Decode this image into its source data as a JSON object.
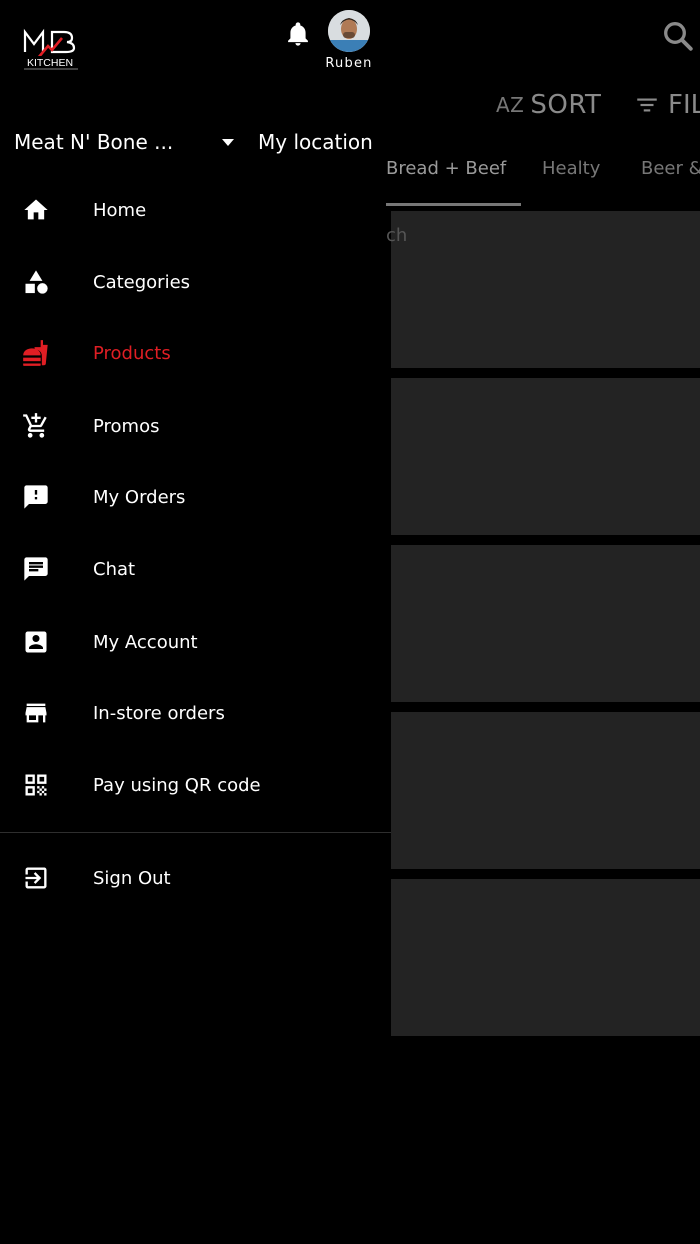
{
  "user": {
    "name": "Ruben"
  },
  "store": {
    "name": "Meat N' Bone ...",
    "location_label": "My location"
  },
  "toolbar": {
    "sort_label": "SORT",
    "sort_icon_text": "AZ",
    "filter_label": "FIL"
  },
  "tabs": [
    {
      "label": "Bread + Beef",
      "active": true
    },
    {
      "label": "Healty",
      "active": false
    },
    {
      "label": "Beer &",
      "active": false
    }
  ],
  "search": {
    "ghost_text": "ch"
  },
  "menu": {
    "items": [
      {
        "label": "Home",
        "icon": "home-icon",
        "active": false
      },
      {
        "label": "Categories",
        "icon": "categories-icon",
        "active": false
      },
      {
        "label": "Products",
        "icon": "fastfood-icon",
        "active": true
      },
      {
        "label": "Promos",
        "icon": "add-to-cart-icon",
        "active": false
      },
      {
        "label": "My Orders",
        "icon": "feedback-icon",
        "active": false
      },
      {
        "label": "Chat",
        "icon": "chat-icon",
        "active": false
      },
      {
        "label": "My Account",
        "icon": "account-box-icon",
        "active": false
      },
      {
        "label": "In-store orders",
        "icon": "store-icon",
        "active": false
      },
      {
        "label": "Pay using QR code",
        "icon": "qr-code-icon",
        "active": false
      }
    ],
    "sign_out": {
      "label": "Sign Out",
      "icon": "exit-icon"
    }
  },
  "colors": {
    "accent": "#e01e24",
    "background": "#000000",
    "card": "#232323",
    "muted": "#8a8a8a"
  }
}
